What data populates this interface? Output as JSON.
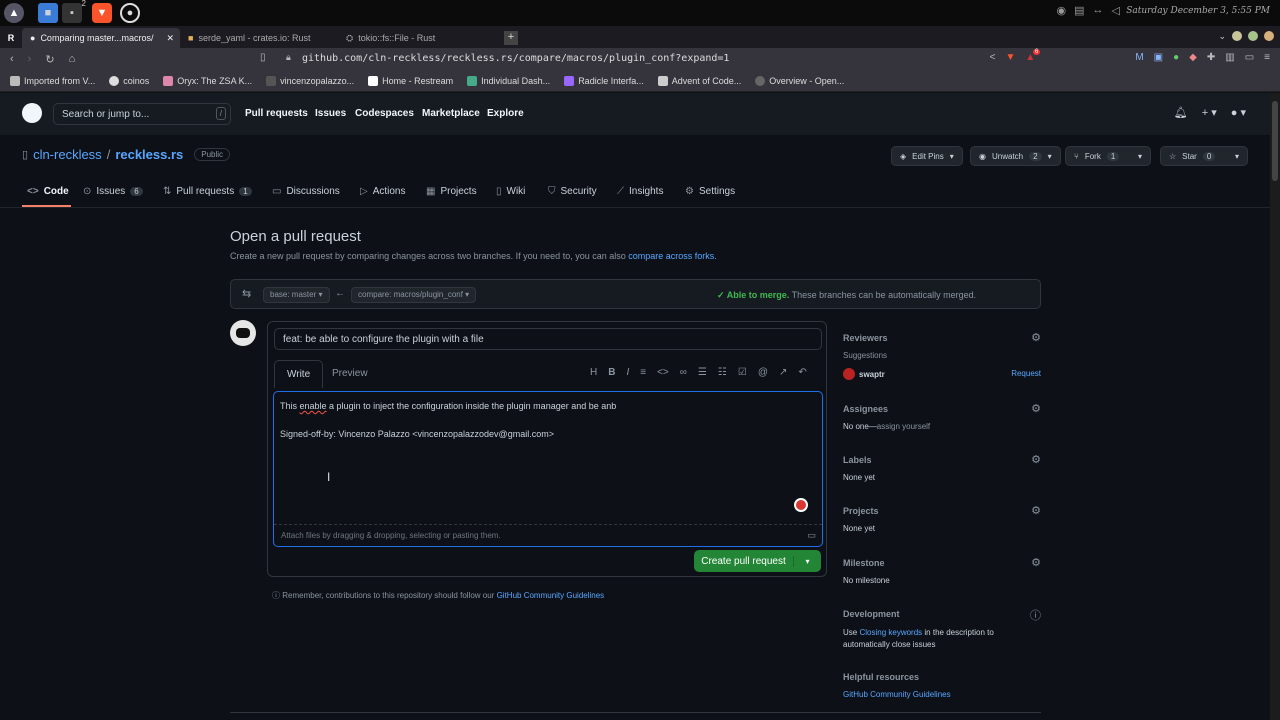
{
  "os": {
    "status": "Saturday December 3, 5:55 PM",
    "ws_badge": "2"
  },
  "tabs": [
    {
      "label": "Comparing master...macros/",
      "active": true
    },
    {
      "label": "serde_yaml - crates.io: Rust"
    },
    {
      "label": "tokio::fs::File - Rust"
    }
  ],
  "address": {
    "url": "github.com/cln-reckless/reckless.rs/compare/macros/plugin_conf?expand=1",
    "ext_badge": "6"
  },
  "bookmarks": [
    "Imported from V...",
    "coinos",
    "Oryx: The ZSA K...",
    "vincenzopalazzo...",
    "Home - Restream",
    "Individual Dash...",
    "Radicle Interfa...",
    "Advent of Code...",
    "Overview - Open..."
  ],
  "gh": {
    "search_placeholder": "Search or jump to...",
    "slash": "/",
    "nav": [
      "Pull requests",
      "Issues",
      "Codespaces",
      "Marketplace",
      "Explore"
    ]
  },
  "repo": {
    "owner": "cln-reckless",
    "sep": "/",
    "name": "reckless.rs",
    "visibility": "Public",
    "buttons": {
      "pins": "Edit Pins",
      "unwatch": "Unwatch",
      "unwatch_count": "2",
      "fork": "Fork",
      "fork_count": "1",
      "star": "Star",
      "star_count": "0"
    },
    "tabs": [
      {
        "label": "Code"
      },
      {
        "label": "Issues",
        "count": "6"
      },
      {
        "label": "Pull requests",
        "count": "1"
      },
      {
        "label": "Discussions"
      },
      {
        "label": "Actions"
      },
      {
        "label": "Projects"
      },
      {
        "label": "Wiki"
      },
      {
        "label": "Security"
      },
      {
        "label": "Insights"
      },
      {
        "label": "Settings"
      }
    ]
  },
  "page": {
    "title": "Open a pull request",
    "subtitle": "Create a new pull request by comparing changes across two branches. If you need to, you can also",
    "subtitle_link": "compare across forks."
  },
  "range": {
    "base": "base: master",
    "compare": "compare: macros/plugin_conf",
    "merge_ok": "Able to merge.",
    "merge_msg": "These branches can be automatically merged."
  },
  "pr": {
    "title": "feat: be able to configure the plugin with a file",
    "write_tab": "Write",
    "preview_tab": "Preview",
    "body_pre": "This ",
    "body_typo": "enable",
    "body_post": " a plugin to inject the configuration inside the plugin manager and be anb",
    "body_sig": "Signed-off-by: Vincenzo Palazzo <vincenzopalazzodev@gmail.com>",
    "attach": "Attach files by dragging & dropping, selecting or pasting them.",
    "create": "Create pull request",
    "remember": "Remember, contributions to this repository should follow our",
    "guidelines": "GitHub Community Guidelines"
  },
  "sidebar": {
    "reviewers": {
      "heading": "Reviewers",
      "suggestions": "Suggestions",
      "user": "swaptr",
      "request": "Request"
    },
    "assignees": {
      "heading": "Assignees",
      "none": "No one—",
      "assign": "assign yourself"
    },
    "labels": {
      "heading": "Labels",
      "value": "None yet"
    },
    "projects": {
      "heading": "Projects",
      "value": "None yet"
    },
    "milestone": {
      "heading": "Milestone",
      "value": "No milestone"
    },
    "development": {
      "heading": "Development",
      "pre": "Use",
      "link": "Closing keywords",
      "post": "in the description to automatically close issues"
    },
    "helpful": {
      "heading": "Helpful resources",
      "link": "GitHub Community Guidelines"
    }
  }
}
